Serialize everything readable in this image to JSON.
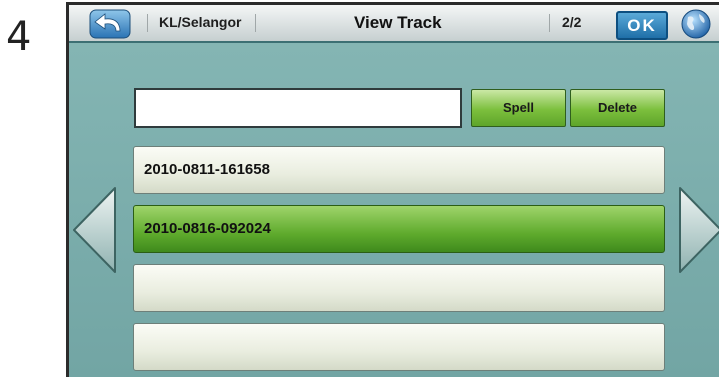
{
  "step_number": "4",
  "header": {
    "region": "KL/Selangor",
    "title": "View Track",
    "page_indicator": "2/2",
    "ok_label": "OK"
  },
  "search": {
    "value": ""
  },
  "buttons": {
    "spell": "Spell",
    "delete": "Delete"
  },
  "tracks": [
    {
      "name": "2010-0811-161658",
      "selected": false
    },
    {
      "name": "2010-0816-092024",
      "selected": true
    },
    {
      "name": "",
      "selected": false
    },
    {
      "name": "",
      "selected": false
    }
  ],
  "icons": [
    "back-arrow-icon",
    "globe-icon",
    "left-arrow-icon",
    "right-arrow-icon"
  ],
  "colors": {
    "selected_row": "#5fab2d",
    "ok_button": "#1f6fa8",
    "screen_bg": "#7fb1b0"
  }
}
